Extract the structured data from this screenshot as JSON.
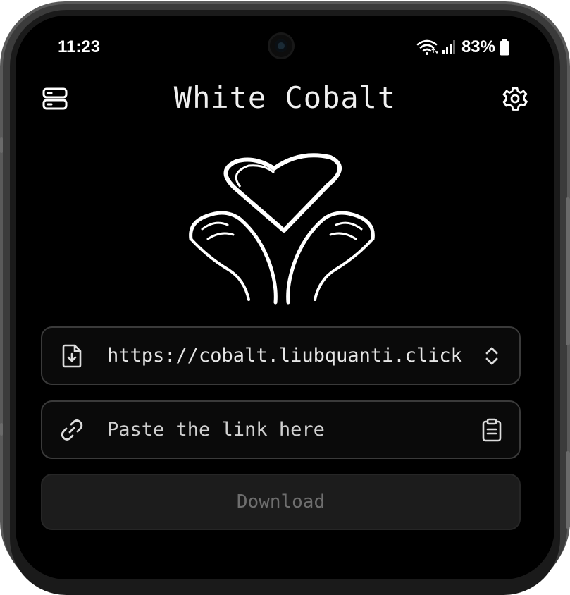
{
  "status_bar": {
    "time": "11:23",
    "battery": "83%",
    "icons": [
      "wifi-icon",
      "signal-icon",
      "battery-icon"
    ]
  },
  "header": {
    "title": "White Cobalt",
    "left_icon": "server-icon",
    "right_icon": "gear-icon"
  },
  "logo": {
    "icon": "heart-hands-logo"
  },
  "instance_selector": {
    "value": "https://cobalt.liubquanti.click",
    "icon": "file-download-icon",
    "right_icon": "chevron-up-down-icon"
  },
  "link_input": {
    "placeholder": "Paste the link here",
    "icon": "link-icon",
    "right_icon": "clipboard-icon"
  },
  "download": {
    "label": "Download"
  },
  "colors": {
    "background": "#000000",
    "text": "#e8e8e8",
    "field_border": "#3a3a3a",
    "button_bg": "#1c1c1c",
    "button_text": "#6e6e6e"
  }
}
